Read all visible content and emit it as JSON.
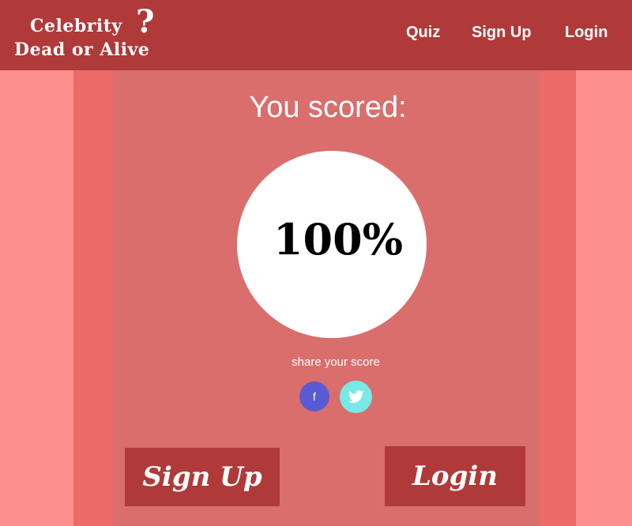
{
  "header": {
    "logo_line1": "Celebrity",
    "logo_qmark": "?",
    "logo_line2": "Dead or Alive",
    "nav": {
      "quiz": "Quiz",
      "signup": "Sign Up",
      "login": "Login"
    }
  },
  "main": {
    "heading": "You scored:",
    "score": "100%",
    "share_text": "share your score",
    "share_facebook_label": "f",
    "signup_label": "Sign Up",
    "login_label": "Login"
  },
  "icons": {
    "facebook": "facebook-icon",
    "twitter": "twitter-icon"
  },
  "colors": {
    "header": "#b0393a",
    "background": "#ff8f8c",
    "outer_column": "#ec6a69",
    "inner_column": "#d96e6d",
    "facebook": "#5a5bd2",
    "twitter": "#78e9e6",
    "score_circle": "#ffffff"
  }
}
